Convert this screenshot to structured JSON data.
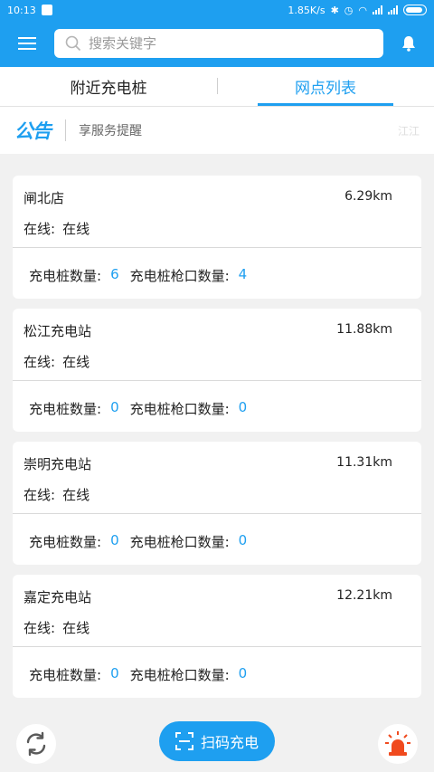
{
  "status_bar": {
    "time": "10:13",
    "speed": "1.85K/s"
  },
  "header": {
    "menu_icon": "menu-icon",
    "search_placeholder": "搜索关键字",
    "search_value": "",
    "bell_icon": "bell-icon"
  },
  "tabs": [
    {
      "label": "附近充电桩",
      "active": false
    },
    {
      "label": "网点列表",
      "active": true
    }
  ],
  "notice": {
    "logo": "公告",
    "text": "享服务提醒",
    "tail": "江江"
  },
  "stations": [
    {
      "name": "闸北店",
      "distance": "6.29km",
      "status_label": "在线:",
      "status_value": "在线",
      "pile_label": "充电桩数量:",
      "pile_count": "6",
      "gun_label": "充电桩枪口数量:",
      "gun_count": "4"
    },
    {
      "name": "松江充电站",
      "distance": "11.88km",
      "status_label": "在线:",
      "status_value": "在线",
      "pile_label": "充电桩数量:",
      "pile_count": "0",
      "gun_label": "充电桩枪口数量:",
      "gun_count": "0"
    },
    {
      "name": "崇明充电站",
      "distance": "11.31km",
      "status_label": "在线:",
      "status_value": "在线",
      "pile_label": "充电桩数量:",
      "pile_count": "0",
      "gun_label": "充电桩枪口数量:",
      "gun_count": "0"
    },
    {
      "name": "嘉定充电站",
      "distance": "12.21km",
      "status_label": "在线:",
      "status_value": "在线",
      "pile_label": "充电桩数量:",
      "pile_count": "0",
      "gun_label": "充电桩枪口数量:",
      "gun_count": "0"
    }
  ],
  "bottom": {
    "refresh_icon": "refresh-icon",
    "scan_label": "扫码充电",
    "scan_icon": "scan-icon",
    "alarm_icon": "alarm-light-icon"
  },
  "colors": {
    "primary": "#1e9ff0",
    "background": "#f1f1f1",
    "alarm": "#f04a1e"
  }
}
